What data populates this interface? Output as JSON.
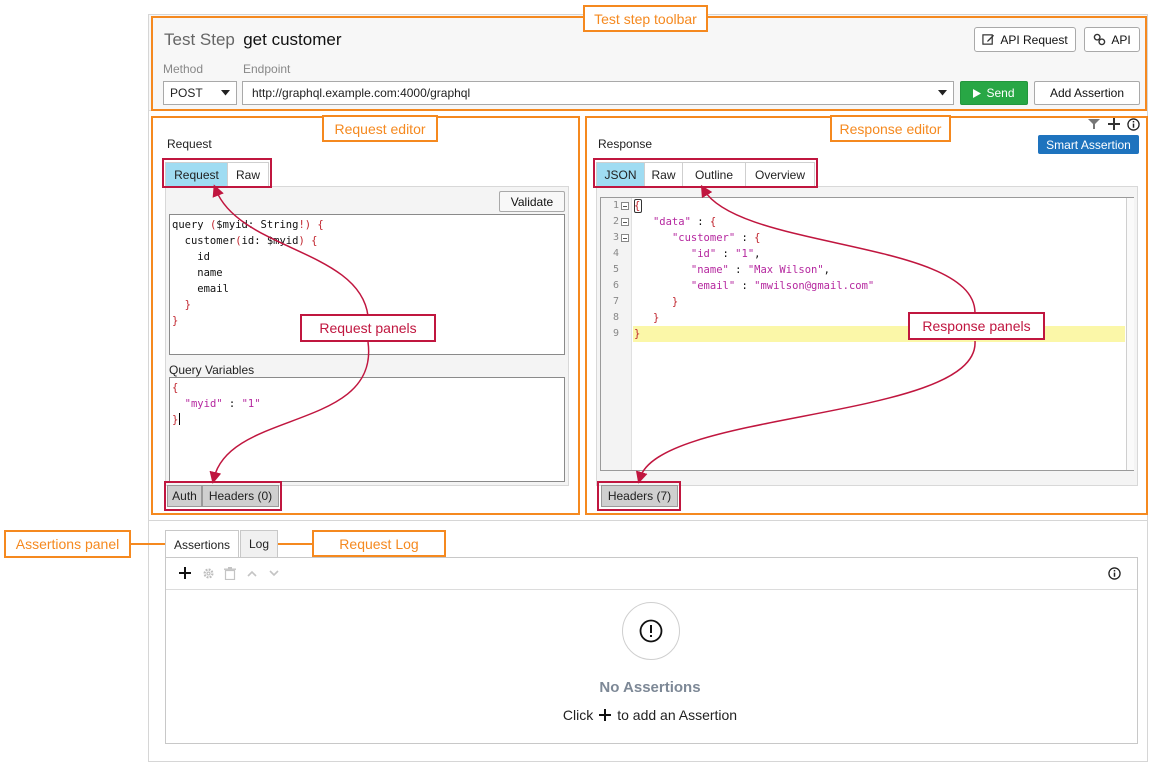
{
  "toolbar": {
    "title_prefix": "Test Step",
    "title_name": "get customer",
    "api_request_label": "API Request",
    "api_label": "API",
    "method_label": "Method",
    "endpoint_label": "Endpoint",
    "method_value": "POST",
    "endpoint_value": "http://graphql.example.com:4000/graphql",
    "send_label": "Send",
    "add_assertion_label": "Add Assertion"
  },
  "request": {
    "title": "Request",
    "tabs": [
      "Request",
      "Raw"
    ],
    "validate_label": "Validate",
    "query_lines": [
      [
        {
          "t": "query ",
          "c": "k"
        },
        {
          "t": "(",
          "c": "r"
        },
        {
          "t": "$myid: String",
          "c": "k"
        },
        {
          "t": "!) {",
          "c": "r"
        }
      ],
      [
        {
          "t": "  customer",
          "c": "k"
        },
        {
          "t": "(",
          "c": "r"
        },
        {
          "t": "id: $myid",
          "c": "k"
        },
        {
          "t": ") {",
          "c": "r"
        }
      ],
      [
        {
          "t": "    id",
          "c": "k"
        }
      ],
      [
        {
          "t": "    name",
          "c": "k"
        }
      ],
      [
        {
          "t": "    email",
          "c": "k"
        }
      ],
      [
        {
          "t": "  }",
          "c": "r"
        }
      ],
      [
        {
          "t": "}",
          "c": "r"
        }
      ]
    ],
    "query_variables_label": "Query Variables",
    "variables_lines": [
      [
        {
          "t": "{",
          "c": "r"
        }
      ],
      [
        {
          "t": "  ",
          "c": "k"
        },
        {
          "t": "\"myid\"",
          "c": "s"
        },
        {
          "t": " : ",
          "c": "k"
        },
        {
          "t": "\"1\"",
          "c": "s"
        }
      ],
      [
        {
          "t": "}",
          "c": "r"
        }
      ]
    ],
    "subtabs": [
      "Auth",
      "Headers (0)"
    ]
  },
  "response": {
    "title": "Response",
    "smart_assertion_label": "Smart Assertion",
    "tabs": [
      "JSON",
      "Raw",
      "Outline",
      "Overview"
    ],
    "line_numbers": [
      "1",
      "2",
      "3",
      "4",
      "5",
      "6",
      "7",
      "8",
      "9"
    ],
    "lines": [
      [
        {
          "t": "{",
          "c": "r"
        }
      ],
      [
        {
          "t": "   ",
          "c": "k"
        },
        {
          "t": "\"data\"",
          "c": "s"
        },
        {
          "t": " : ",
          "c": "k"
        },
        {
          "t": "{",
          "c": "r"
        }
      ],
      [
        {
          "t": "      ",
          "c": "k"
        },
        {
          "t": "\"customer\"",
          "c": "s"
        },
        {
          "t": " : ",
          "c": "k"
        },
        {
          "t": "{",
          "c": "r"
        }
      ],
      [
        {
          "t": "         ",
          "c": "k"
        },
        {
          "t": "\"id\"",
          "c": "s"
        },
        {
          "t": " : ",
          "c": "k"
        },
        {
          "t": "\"1\"",
          "c": "s"
        },
        {
          "t": ",",
          "c": "k"
        }
      ],
      [
        {
          "t": "         ",
          "c": "k"
        },
        {
          "t": "\"name\"",
          "c": "s"
        },
        {
          "t": " : ",
          "c": "k"
        },
        {
          "t": "\"Max Wilson\"",
          "c": "s"
        },
        {
          "t": ",",
          "c": "k"
        }
      ],
      [
        {
          "t": "         ",
          "c": "k"
        },
        {
          "t": "\"email\"",
          "c": "s"
        },
        {
          "t": " : ",
          "c": "k"
        },
        {
          "t": "\"mwilson@gmail.com\"",
          "c": "s"
        }
      ],
      [
        {
          "t": "      }",
          "c": "r"
        }
      ],
      [
        {
          "t": "   }",
          "c": "r"
        }
      ],
      [
        {
          "t": "}",
          "c": "r"
        }
      ]
    ],
    "subtabs": [
      "Headers (7)"
    ]
  },
  "bottom": {
    "tabs": [
      "Assertions",
      "Log"
    ],
    "empty_title": "No Assertions",
    "empty_prefix": "Click",
    "empty_suffix": "to add an Assertion"
  },
  "annotations": {
    "test_step_toolbar": "Test step toolbar",
    "request_editor": "Request editor",
    "response_editor": "Response editor",
    "request_panels": "Request panels",
    "response_panels": "Response panels",
    "assertions_panel": "Assertions panel",
    "request_log": "Request Log"
  },
  "colors": {
    "annotation_orange": "#f5891f",
    "annotation_red": "#c0163f",
    "active_tab": "#9fdcf2",
    "send_green": "#28a745",
    "smart_blue": "#1e73be"
  },
  "icons": [
    "edit-icon",
    "link-icon",
    "dropdown-icon",
    "play-icon",
    "filter-icon",
    "plus-icon",
    "info-icon",
    "gear-icon",
    "trash-icon",
    "chevron-up-icon",
    "chevron-down-icon",
    "alert-icon"
  ]
}
